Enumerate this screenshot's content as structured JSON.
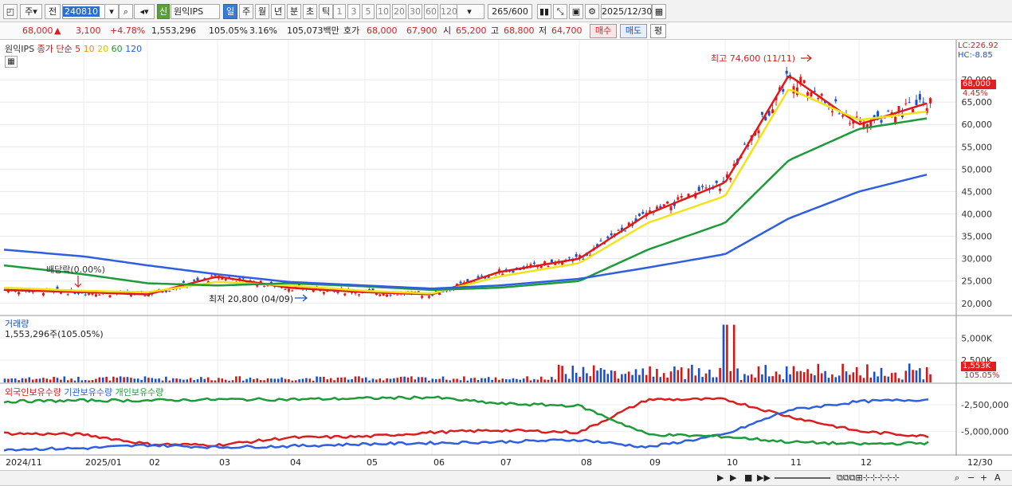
{
  "toolbar": {
    "type_select": "주",
    "prev_label": "전",
    "code": "240810",
    "stock_name": "원익IPS",
    "badge": "신",
    "periods": [
      "일",
      "주",
      "월",
      "년",
      "분",
      "초",
      "틱"
    ],
    "active_period": "일",
    "minutes": [
      "1",
      "3",
      "5",
      "10",
      "20",
      "30",
      "60",
      "120"
    ],
    "count": "265",
    "count_total": "/600",
    "date": "2025/12/30"
  },
  "quote": {
    "price": "68,000",
    "change": "3,100",
    "rate": "+4.78%",
    "volume": "1,553,296",
    "vol_ratio": "105.05%",
    "turnover": "3.16%",
    "amount": "105,073백만",
    "ask_label": "호가",
    "ask": "68,000",
    "bid": "67,900",
    "open_label": "시",
    "open": "65,200",
    "high_label": "고",
    "high": "68,800",
    "low_label": "저",
    "low": "64,700",
    "buy": "매수",
    "sell": "매도",
    "eval": "평"
  },
  "price_panel": {
    "legend_name": "원익IPS",
    "legend_ma": "종가 단순",
    "ma_periods": [
      "5",
      "10",
      "20",
      "60",
      "120"
    ],
    "lc": "LC:226.92",
    "hc": "HC:-8.85",
    "current_badge": "68,000",
    "current_pct": "4.45%",
    "hi_annotation": "최고 74,600 (11/11)",
    "lo_annotation": "최저 20,800 (04/09)",
    "div_annotation": "배당락(0.00%)",
    "ticks": [
      "70,000",
      "65,000",
      "60,000",
      "55,000",
      "50,000",
      "45,000",
      "40,000",
      "35,000",
      "30,000",
      "25,000",
      "20,000"
    ]
  },
  "volume_panel": {
    "title": "거래량",
    "value": "1,553,296주(105.05%)",
    "ticks": [
      "5,000K",
      "2,500K"
    ],
    "badge": "1,553K",
    "badge_pct": "105.05%"
  },
  "holding_panel": {
    "legend": [
      "외국인보유수량",
      "기관보유수량",
      "개인보유수량"
    ],
    "ticks": [
      "-2,500,000",
      "-5,000,000"
    ]
  },
  "xaxis": [
    "2024/11",
    "2025/01",
    "02",
    "03",
    "04",
    "05",
    "06",
    "07",
    "08",
    "09",
    "10",
    "11",
    "12",
    "12/30"
  ],
  "colors": {
    "ma5": "#e01818",
    "ma10": "#f08a10",
    "ma20": "#f2e21a",
    "ma60": "#1e9a3a",
    "ma120": "#2f5fe0",
    "up": "#e01818",
    "down": "#1a4fd0"
  },
  "chart_data": {
    "type": "line",
    "title": "",
    "x": [
      "2024/11",
      "2025/01",
      "02",
      "03",
      "04",
      "05",
      "06",
      "07",
      "08",
      "09",
      "10",
      "11",
      "12",
      "12/30"
    ],
    "series": [
      {
        "name": "5",
        "values": [
          23000,
          22500,
          22000,
          26000,
          23500,
          22500,
          22000,
          27000,
          30000,
          40000,
          47000,
          71000,
          60000,
          65000
        ]
      },
      {
        "name": "20",
        "values": [
          23500,
          22800,
          22500,
          24800,
          24000,
          22800,
          22200,
          26000,
          29000,
          38000,
          44000,
          68000,
          61000,
          63000
        ]
      },
      {
        "name": "60",
        "values": [
          28500,
          26500,
          24500,
          24000,
          24500,
          23800,
          23000,
          23500,
          25000,
          32000,
          38000,
          52000,
          59000,
          61500
        ]
      },
      {
        "name": "120",
        "values": [
          32000,
          30500,
          28500,
          26500,
          24800,
          24000,
          23300,
          24000,
          25500,
          28000,
          31000,
          39000,
          45000,
          49000
        ]
      }
    ],
    "ylim": [
      18000,
      75000
    ]
  }
}
